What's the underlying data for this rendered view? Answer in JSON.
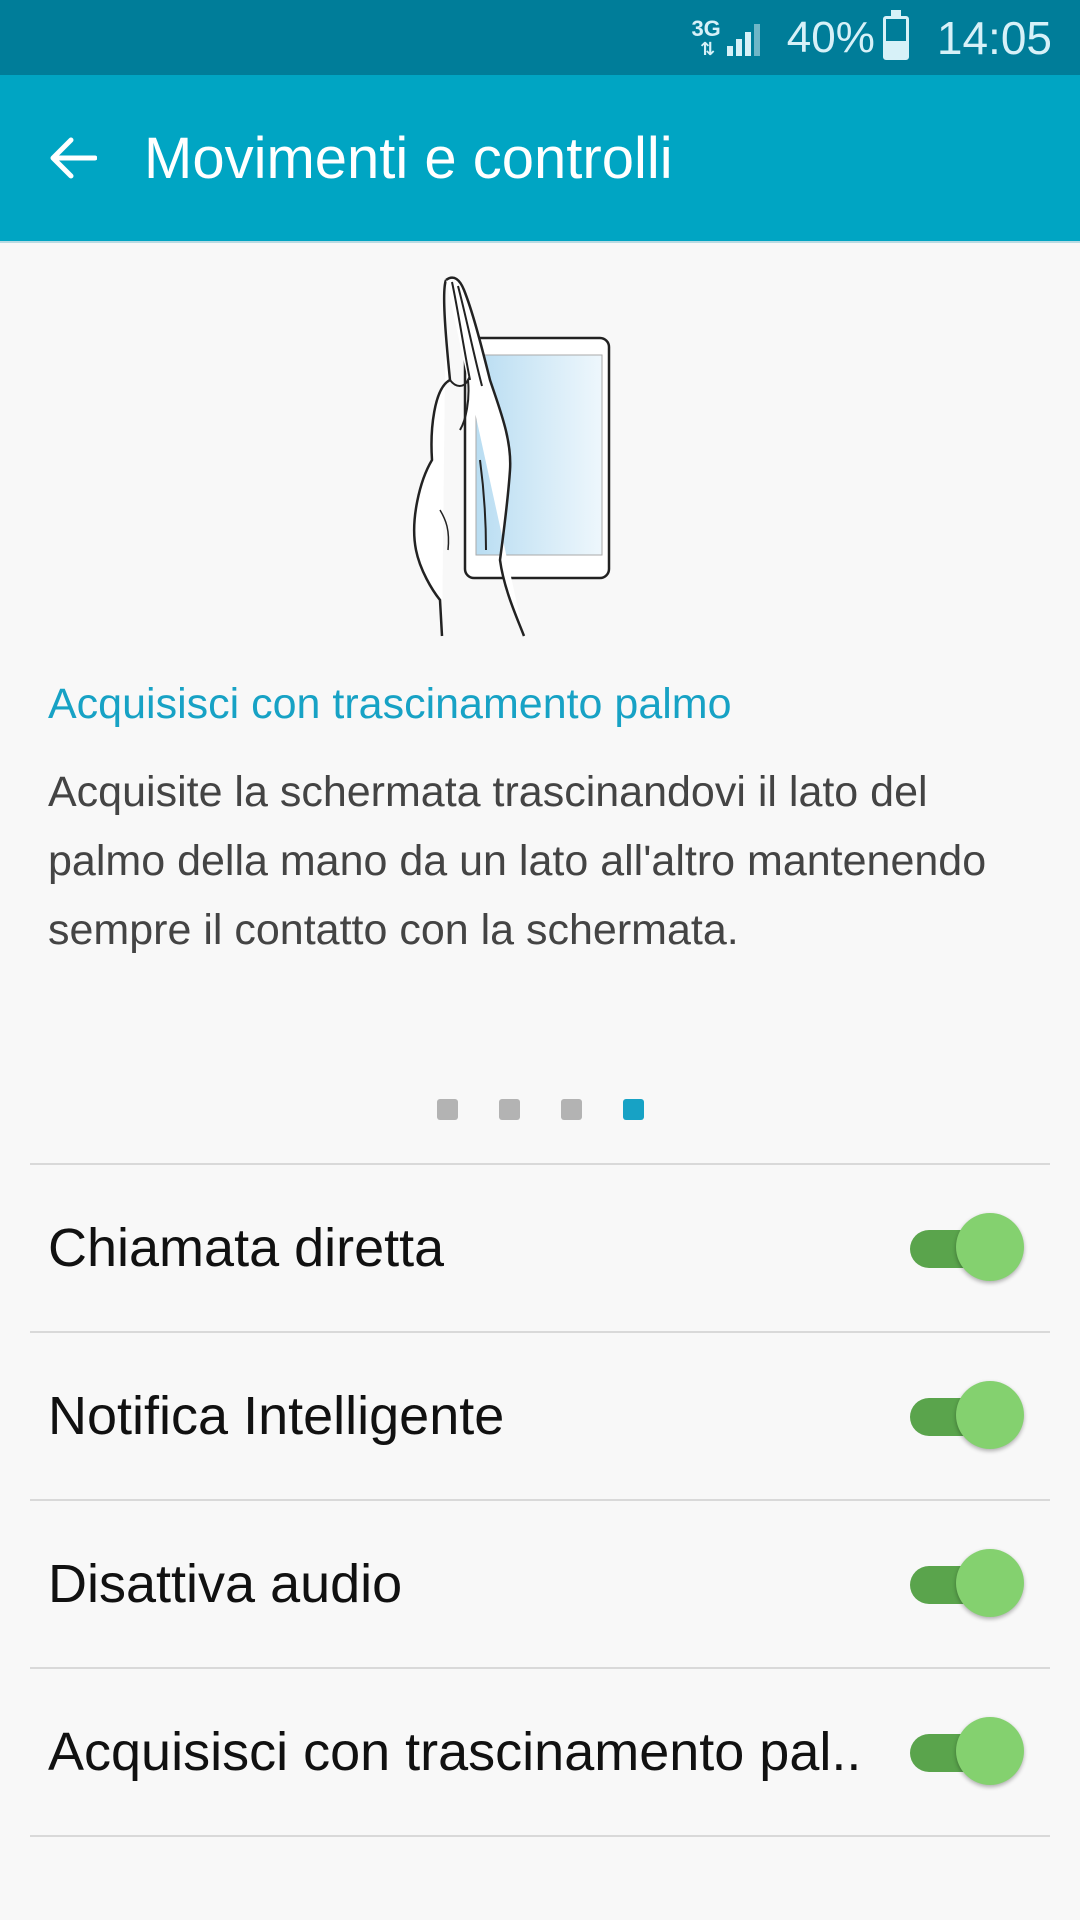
{
  "status_bar": {
    "network": "3G",
    "battery": "40%",
    "battery_level": 0.4,
    "time": "14:05"
  },
  "app_bar": {
    "title": "Movimenti e controlli",
    "back_icon": "arrow-back-icon"
  },
  "feature": {
    "illustration": "hand-swipe-screen-illustration",
    "title": "Acquisisci con trascinamento palmo",
    "description": "Acquisite la schermata trascinandovi il lato del palmo della mano da un lato all'altro mantenendo sempre il contatto con la schermata."
  },
  "pager": {
    "count": 4,
    "active_index": 3
  },
  "settings": [
    {
      "label": "Chiamata diretta",
      "enabled": true
    },
    {
      "label": "Notifica Intelligente",
      "enabled": true
    },
    {
      "label": "Disattiva audio",
      "enabled": true
    },
    {
      "label": "Acquisisci con trascinamento pal..",
      "enabled": true
    }
  ],
  "colors": {
    "status_bar": "#007d99",
    "app_bar": "#00a5c3",
    "accent": "#17a2c5",
    "toggle_track": "#5aa44c",
    "toggle_thumb": "#84d16f"
  }
}
